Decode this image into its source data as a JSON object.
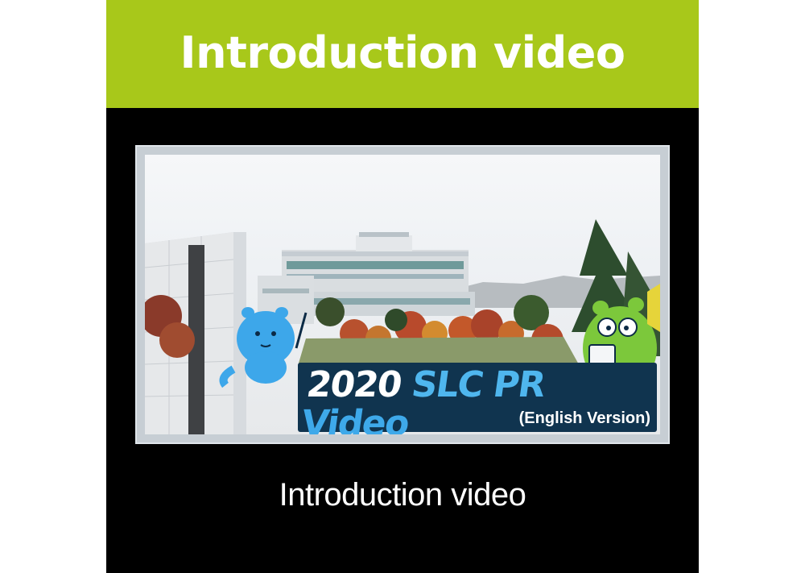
{
  "header": {
    "title": "Introduction video"
  },
  "thumbnail": {
    "year": "2020",
    "title_slc": "SLC",
    "title_pr": "PR",
    "title_video": "Video",
    "subtitle": "(English Version)"
  },
  "caption": "Introduction video",
  "colors": {
    "header_bg": "#a8c81a",
    "card_bg": "#000000",
    "title_box": "#10344f",
    "title_accent": "#4fb6ee"
  }
}
